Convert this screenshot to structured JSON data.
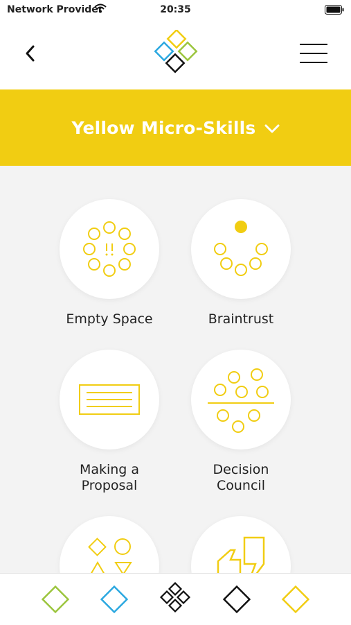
{
  "status_bar": {
    "provider": "Network Provider",
    "time": "20:35",
    "wifi_icon": "wifi-icon",
    "battery_icon": "battery-icon"
  },
  "nav": {
    "back_icon": "chevron-left-icon",
    "logo_icon": "diamond-cluster-logo",
    "menu_icon": "hamburger-icon"
  },
  "banner": {
    "title": "Yellow Micro-Skills",
    "chevron_icon": "chevron-down-icon",
    "color": "#f1cd12"
  },
  "skills": [
    {
      "label": "Empty Space",
      "icon": "empty-space-icon"
    },
    {
      "label": "Braintrust",
      "icon": "braintrust-icon"
    },
    {
      "label": "Making a\nProposal",
      "icon": "proposal-icon"
    },
    {
      "label": "Decision\nCouncil",
      "icon": "decision-council-icon"
    },
    {
      "label": "",
      "icon": "shapes-icon"
    },
    {
      "label": "",
      "icon": "quote-icon"
    }
  ],
  "bottom_tabs": [
    {
      "name": "green",
      "color": "#9bc53d",
      "icon": "diamond-icon"
    },
    {
      "name": "blue",
      "color": "#2ba8e0",
      "icon": "diamond-icon"
    },
    {
      "name": "all",
      "color": "#111111",
      "icon": "diamond-cluster-icon"
    },
    {
      "name": "black",
      "color": "#111111",
      "icon": "diamond-icon"
    },
    {
      "name": "yellow",
      "color": "#f1cd12",
      "icon": "diamond-icon"
    }
  ],
  "colors": {
    "accent_yellow": "#f1cd12",
    "green": "#9bc53d",
    "blue": "#2ba8e0",
    "black": "#111111"
  }
}
